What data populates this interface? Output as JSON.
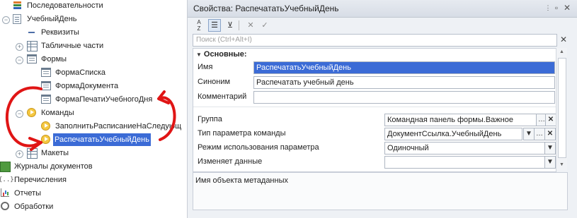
{
  "tree": {
    "items": [
      {
        "label": "Последовательности",
        "icon": "stack-icon"
      },
      {
        "label": "УчебныйДень",
        "icon": "document-icon"
      },
      {
        "label": "Реквизиты",
        "icon": "attribute-icon"
      },
      {
        "label": "Табличные части",
        "icon": "table-icon"
      },
      {
        "label": "Формы",
        "icon": "form-icon"
      },
      {
        "label": "ФормаСписка",
        "icon": "form-icon"
      },
      {
        "label": "ФормаДокумента",
        "icon": "form-icon"
      },
      {
        "label": "ФормаПечатиУчебногоДня",
        "icon": "form-icon"
      },
      {
        "label": "Команды",
        "icon": "command-icon"
      },
      {
        "label": "ЗаполнитьРасписаниеНаСледующ",
        "icon": "command-icon"
      },
      {
        "label": "РаспечататьУчебныйДень",
        "icon": "command-icon"
      },
      {
        "label": "Макеты",
        "icon": "template-icon"
      },
      {
        "label": "Журналы документов",
        "icon": "journal-icon"
      },
      {
        "label": "Перечисления",
        "icon": "enum-icon"
      },
      {
        "label": "Отчеты",
        "icon": "report-icon"
      },
      {
        "label": "Обработки",
        "icon": "processing-icon"
      }
    ]
  },
  "panel": {
    "title": "Свойства: РаспечататьУчебныйДень",
    "search_placeholder": "Поиск (Ctrl+Alt+I)",
    "section": "Основные:",
    "props": [
      {
        "label": "Имя",
        "value": "РаспечататьУчебныйДень"
      },
      {
        "label": "Синоним",
        "value": "Распечатать учебный день"
      },
      {
        "label": "Комментарий",
        "value": ""
      },
      {
        "label": "Группа",
        "value": "Командная панель формы.Важное"
      },
      {
        "label": "Тип параметра команды",
        "value": "ДокументСсылка.УчебныйДень"
      },
      {
        "label": "Режим использования параметра",
        "value": "Одиночный"
      },
      {
        "label": "Изменяет данные",
        "value": ""
      }
    ],
    "description": "Имя объекта метаданных"
  },
  "colors": {
    "selection": "#3b6bd6",
    "annotation": "#e01515"
  }
}
